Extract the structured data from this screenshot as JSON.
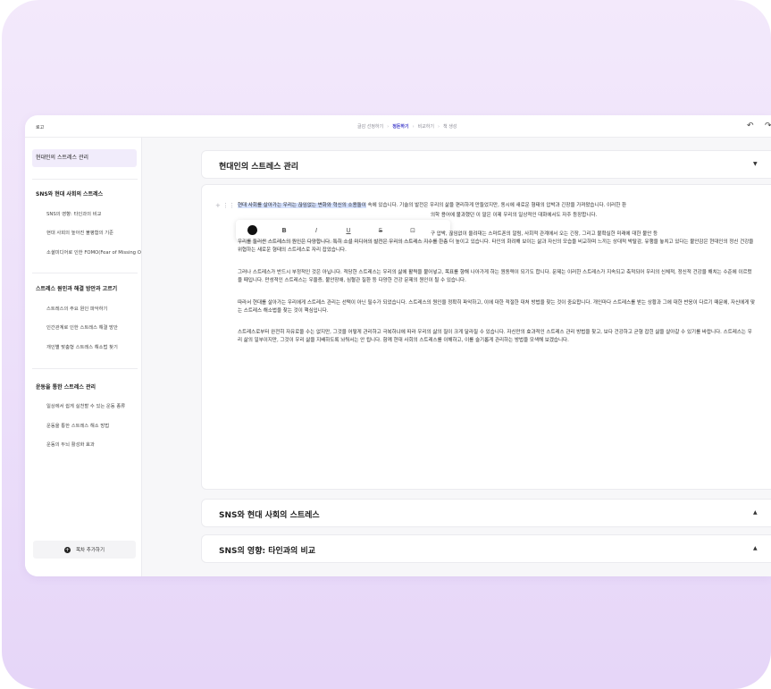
{
  "topbar": {
    "logo": "로고",
    "steps": [
      {
        "label": "글감 선정하기",
        "active": false
      },
      {
        "label": "정돈하기",
        "active": true
      },
      {
        "label": "비교하기",
        "active": false
      },
      {
        "label": "책 생성",
        "active": false
      }
    ],
    "step_sep": "›",
    "undo_icon": "↶",
    "redo_icon": "↷"
  },
  "sidebar": {
    "selected": "현대인의 스트레스 관리",
    "sections": [
      {
        "title": "SNS와 현대 사회의 스트레스",
        "items": [
          "SNS의 영향: 타인과의 비교",
          "현대 사회의 높아진 불평함의 기준",
          "소셜미디어로 인한 FOMO(Fear of Missing Out)"
        ]
      },
      {
        "title": "스트레스 원인과 해결 방안과 고르기",
        "items": [
          "스트레스의 주요 원인 파악하기",
          "인간관계로 인한 스트레스 해결 방안",
          "개인별 맞춤형 스트레스 해소법 찾기"
        ]
      },
      {
        "title": "운동을 통한 스트레스 관리",
        "items": [
          "일상에서 쉽게 실천할 수 있는 운동 종류",
          "운동을 통한 스트레스 해소 방법",
          "운동의 두뇌 활성화 효과"
        ]
      }
    ],
    "add_button": "목차 추가하기"
  },
  "main": {
    "card1_title": "현대인의 스트레스 관리",
    "caret_down": "▼",
    "caret_up": "▲",
    "toolbar": {
      "bold": "B",
      "italic": "I",
      "underline": "U",
      "strike": "S",
      "comment": "⊡"
    },
    "drag": "+ ⋮⋮",
    "p1_highlight": "현대 사회를 살아가는 우리는 끊임없는 변화와 혁신의 소용돌이",
    "p1_rest": " 속에 있습니다. 기술의 발전은 우리의 삶을 편리하게 만들었지만, 동시에 새로운 형태의 압박과 긴장을 가져왔습니다. 이러한 환",
    "p1_line2": "의학 용어에 불과했던 이 말은 이제 우리의 일상적인 대화에서도 자주 등장합니다.",
    "p2_line1": "구 압박, 끊임없이 울려대는 스마트폰의 알림, 사회적 관계에서 오는 긴장, 그리고 불확실한 미래에 대한 불안 등",
    "p2_rest": "우리를 둘러싼 스트레스의 원인은 다양합니다. 특히 소셜 미디어의 발전은 우리의 스트레스 지수를 한층 더 높이고 있습니다. 타인의 화려해 보이는 삶과 자신의 모습을 비교하며 느끼는 상대적 박탈감, 유행을 놓치고 있다는 불안감은 현대인의 정신 건강을 위협하는 새로운 형태의 스트레스로 자리 잡았습니다.",
    "p3": "그러나 스트레스가 반드시 부정적인 것은 아닙니다. 적당한 스트레스는 우리의 삶에 활력을 불어넣고, 목표를 향해 나아가게 하는 원동력이 되기도 합니다. 문제는 이러한 스트레스가 지속되고 축적되어 우리의 신체적, 정신적 건강을 해치는 수준에 이르렀을 때입니다. 만성적인 스트레스는 우울증, 불안장애, 심혈관 질환 등 다양한 건강 문제의 원인이 될 수 있습니다.",
    "p4": "따라서 현대를 살아가는 우리에게 스트레스 관리는 선택이 아닌 필수가 되었습니다. 스트레스의 원인을 정확히 파악하고, 이에 대한 적절한 대처 방법을 찾는 것이 중요합니다. 개인마다 스트레스를 받는 상황과 그에 대한 반응이 다르기 때문에, 자신에게 맞는 스트레스 해소법을 찾는 것이 핵심입니다.",
    "p5": "스트레스로부터 완전히 자유로울 수는 없지만, 그것을 어떻게 관리하고 극복하냐에 따라 우리의 삶의 질이 크게 달라질 수 있습니다. 자신만의 효과적인 스트레스 관리 방법을 찾고, 보다 건강하고 균형 잡힌 삶을 살아갈 수 있기를 바랍니다. 스트레스는 우리 삶의 일부이지만, 그것이 우리 삶을 지배하도록 놔둬서는 안 됩니다. 함께 현대 사회의 스트레스를 이해하고, 이를 슬기롭게 관리하는 방법을 모색해 보겠습니다.",
    "card2_title": "SNS와 현대 사회의 스트레스",
    "card3_title": "SNS의 영향: 타인과의 비교"
  }
}
